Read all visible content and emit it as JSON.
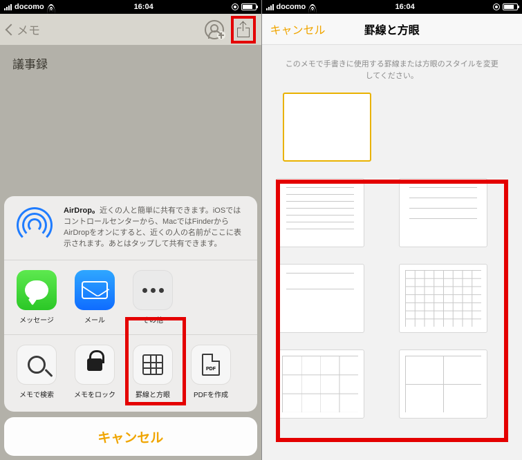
{
  "status": {
    "carrier": "docomo",
    "time": "16:04"
  },
  "left": {
    "back_label": "メモ",
    "note_title": "議事録",
    "airdrop_title": "AirDrop。",
    "airdrop_text": "近くの人と簡単に共有できます。iOSではコントロールセンターから、MacではFinderからAirDropをオンにすると、近くの人の名前がここに表示されます。あとはタップして共有できます。",
    "apps": {
      "message": "メッセージ",
      "mail": "メール",
      "more": "その他"
    },
    "actions": {
      "find": "メモで検索",
      "lock": "メモをロック",
      "lines": "罫線と方眼",
      "pdf": "PDFを作成",
      "pdf_badge": "PDF"
    },
    "cancel": "キャンセル"
  },
  "right": {
    "cancel": "キャンセル",
    "title": "罫線と方眼",
    "desc": "このメモで手書きに使用する罫線または方眼のスタイルを変更してください。"
  }
}
